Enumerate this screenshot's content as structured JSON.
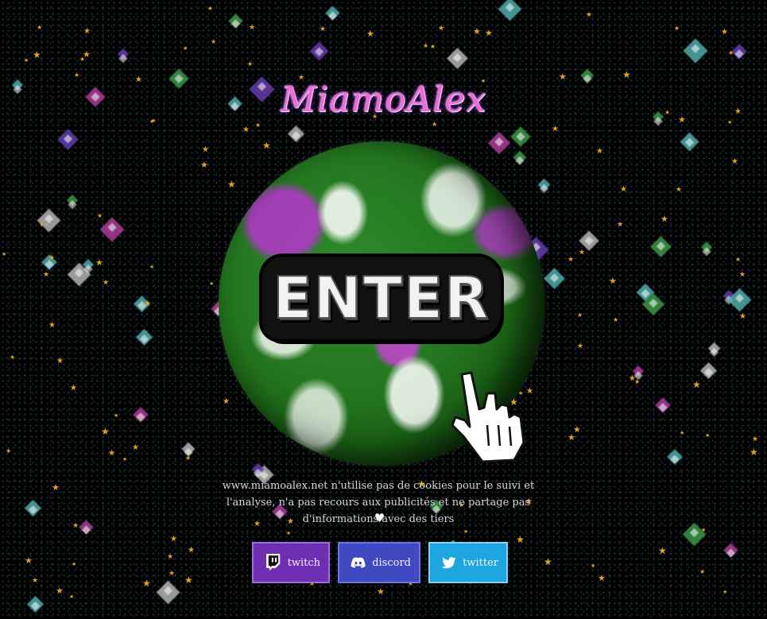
{
  "site": {
    "title": "MiamoAlex",
    "enter_label": "ENTER",
    "notice_text": "www.miamoalex.net n'utilise pas de cookies pour le suivi et l'analyse, n'a pas recours aux publicités et ne partage pas d'informations avec des tiers",
    "heart": "♥"
  },
  "socials": [
    {
      "label": "twitch",
      "icon": "twitch-icon",
      "color": "#6f2fb3"
    },
    {
      "label": "discord",
      "icon": "discord-icon",
      "color": "#4149c0"
    },
    {
      "label": "twitter",
      "icon": "twitter-icon",
      "color": "#1fa6e0"
    }
  ],
  "colors": {
    "background": "#000000",
    "title_pink": "#f06ad2",
    "star_gold": "#e4a21e",
    "globe_green": "#23761f",
    "globe_magenta": "#aa3cbe"
  }
}
